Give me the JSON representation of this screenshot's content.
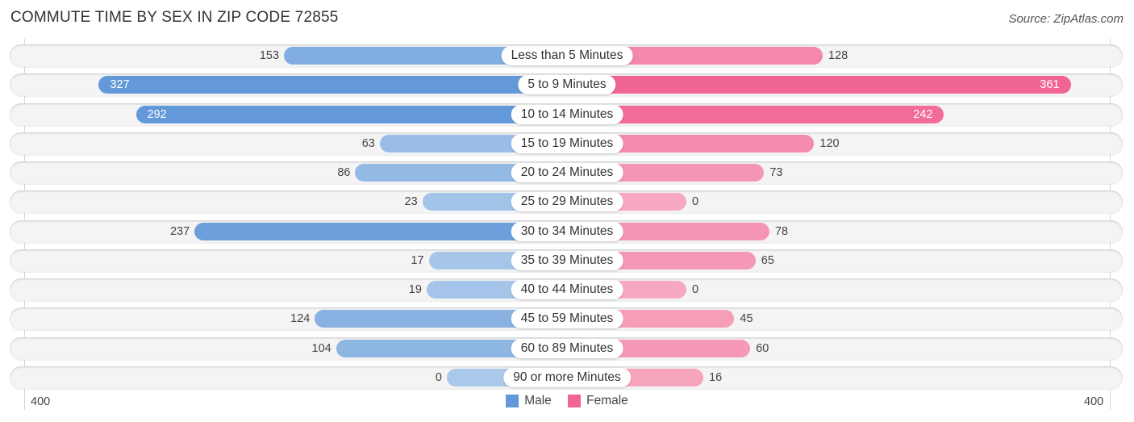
{
  "header": {
    "title": "COMMUTE TIME BY SEX IN ZIP CODE 72855",
    "source": "Source: ZipAtlas.com"
  },
  "colors": {
    "male_strong": "#6399d9",
    "male_light": "#a9c8ea",
    "female_strong": "#f06592",
    "female_light": "#f7a8c0"
  },
  "chart_data": {
    "type": "bar",
    "orientation": "horizontal-diverging",
    "title": "COMMUTE TIME BY SEX IN ZIP CODE 72855",
    "categories": [
      "Less than 5 Minutes",
      "5 to 9 Minutes",
      "10 to 14 Minutes",
      "15 to 19 Minutes",
      "20 to 24 Minutes",
      "25 to 29 Minutes",
      "30 to 34 Minutes",
      "35 to 39 Minutes",
      "40 to 44 Minutes",
      "45 to 59 Minutes",
      "60 to 89 Minutes",
      "90 or more Minutes"
    ],
    "series": [
      {
        "name": "Male",
        "side": "left",
        "values": [
          153,
          327,
          292,
          63,
          86,
          23,
          237,
          17,
          19,
          124,
          104,
          0
        ]
      },
      {
        "name": "Female",
        "side": "right",
        "values": [
          128,
          361,
          242,
          120,
          73,
          0,
          78,
          65,
          0,
          45,
          60,
          16
        ]
      }
    ],
    "axis": {
      "left_max_label": "400",
      "right_max_label": "400",
      "range": [
        0,
        400
      ]
    },
    "legend": {
      "position": "bottom-center",
      "entries": [
        "Male",
        "Female"
      ]
    },
    "grid": true
  }
}
